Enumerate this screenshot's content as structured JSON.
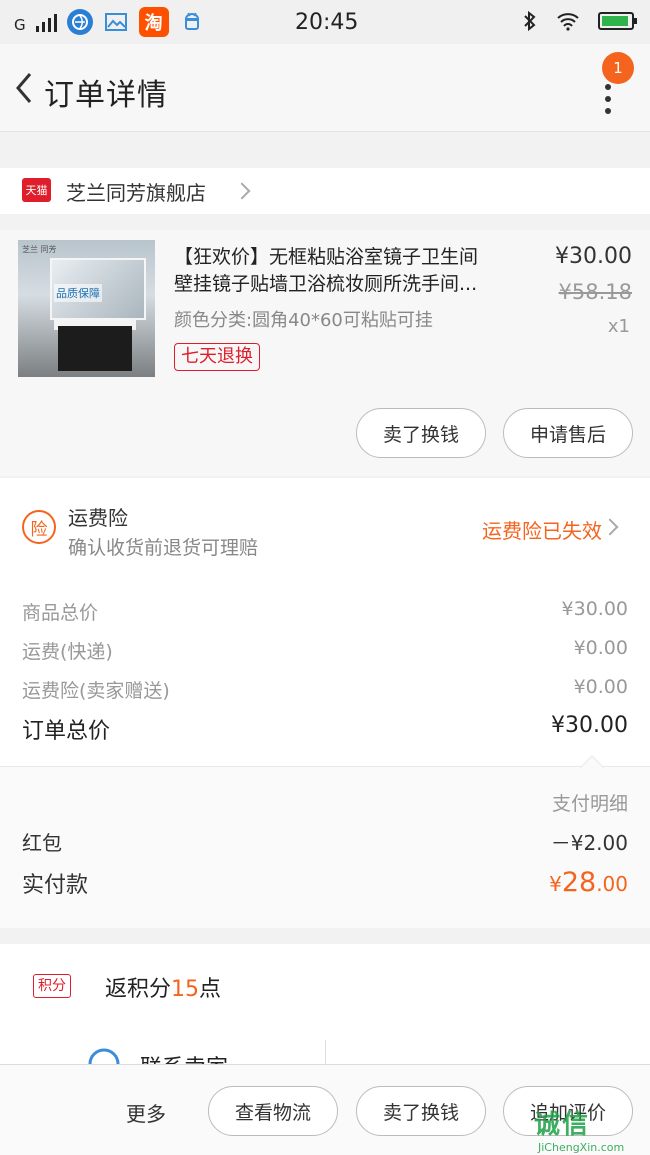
{
  "status_bar": {
    "network": "G",
    "time": "20:45",
    "taobao_icon_text": "淘",
    "icons": [
      "signal-icon",
      "browser-icon",
      "gallery-icon",
      "taobao-icon",
      "android-icon",
      "bluetooth-icon",
      "wifi-icon",
      "battery-icon"
    ]
  },
  "nav": {
    "title": "订单详情",
    "notification_count": "1"
  },
  "shop": {
    "tmall_badge": "天猫",
    "name": "芝兰同芳旗舰店"
  },
  "item": {
    "title_line1": "【狂欢价】无框粘贴浴室镜子卫生间",
    "title_line2": "壁挂镜子贴墙卫浴梳妆厕所洗手间...",
    "sku": "颜色分类:圆角40*60可粘贴可挂",
    "tag": "七天退换",
    "price": "¥30.00",
    "original_price": "¥58.18",
    "quantity": "x1",
    "thumb_text": "品质保障",
    "thumb_brand": "芝兰 同芳"
  },
  "item_actions": {
    "sell": "卖了换钱",
    "after_sale": "申请售后"
  },
  "insurance": {
    "icon_text": "险",
    "title": "运费险",
    "desc": "确认收货前退货可理赔",
    "status": "运费险已失效"
  },
  "summary": {
    "rows": [
      {
        "label": "商品总价",
        "value": "¥30.00"
      },
      {
        "label": "运费(快递)",
        "value": "¥0.00"
      },
      {
        "label": "运费险(卖家赠送)",
        "value": "¥0.00"
      }
    ],
    "total_label": "订单总价",
    "total_value": "¥30.00"
  },
  "payment": {
    "detail_label": "支付明细",
    "redpacket_label": "红包",
    "redpacket_value": "－¥2.00",
    "paid_label": "实付款",
    "paid_currency": "¥",
    "paid_int": "28",
    "paid_dec": ".00"
  },
  "points": {
    "tag": "积分",
    "text_prefix": "返积分",
    "amount": "15",
    "text_suffix": "点"
  },
  "contact": {
    "label": "联系卖家"
  },
  "bottom_bar": {
    "more": "更多",
    "logistics": "查看物流",
    "sell": "卖了换钱",
    "review": "追加评价"
  },
  "watermark": {
    "main": "诚信",
    "sub": "JiChengXin.com"
  },
  "colors": {
    "accent": "#f5641e",
    "tmall_red": "#e01e2b",
    "watermark_green": "#1da146"
  }
}
